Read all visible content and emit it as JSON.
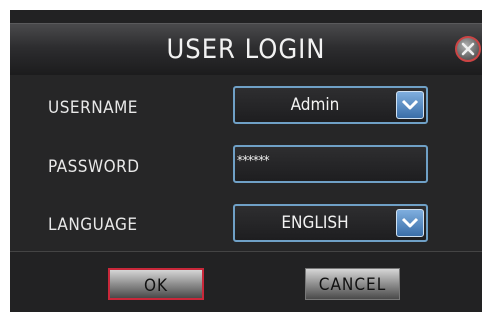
{
  "dialog": {
    "title": "USER LOGIN",
    "username_label": "USERNAME",
    "username_value": "Admin",
    "password_label": "PASSWORD",
    "password_value": "******",
    "language_label": "LANGUAGE",
    "language_value": "ENGLISH",
    "ok_label": "OK",
    "cancel_label": "CANCEL"
  },
  "colors": {
    "field_border": "#6fa0c6",
    "ok_border": "#c9283a",
    "background": "#222223"
  }
}
